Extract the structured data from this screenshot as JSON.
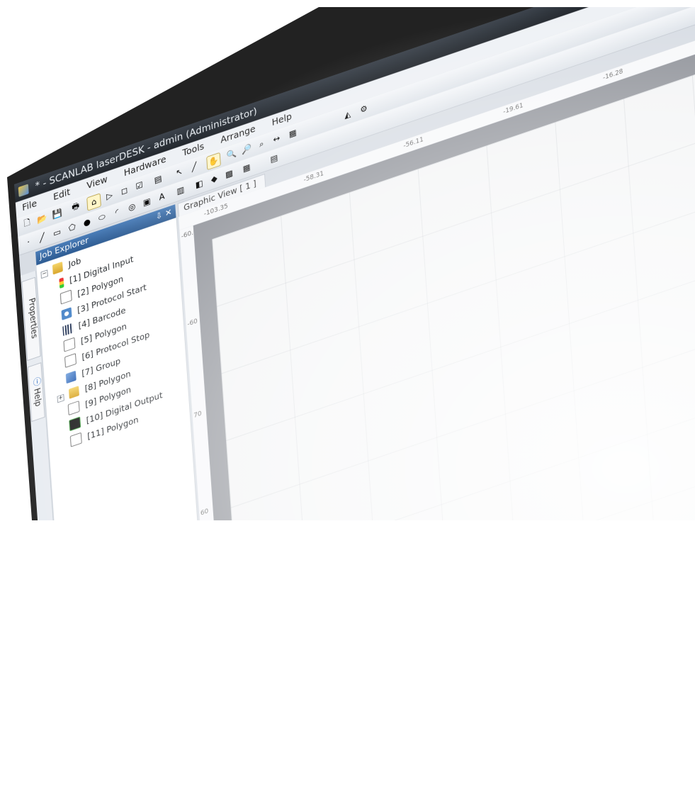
{
  "window": {
    "title": "* - SCANLAB laserDESK - admin (Administrator)"
  },
  "menu": [
    "File",
    "Edit",
    "View",
    "Hardware",
    "Tools",
    "Arrange",
    "Help"
  ],
  "panel": {
    "title": "Job Explorer",
    "controls": "⇩ ✕"
  },
  "side_tabs": {
    "properties": "Properties",
    "help": "Help"
  },
  "tree": {
    "root": "Job",
    "items": [
      "[1] Digital Input",
      "[2] Polygon",
      "[3] Protocol Start",
      "[4] Barcode",
      "[5] Polygon",
      "[6] Protocol Stop",
      "[7] Group",
      "[8] Polygon",
      "[9] Polygon",
      "[10] Digital Output",
      "[11] Polygon"
    ]
  },
  "graphic_view": {
    "tab_label": "Graphic View [ 1 ]"
  },
  "ruler": {
    "top_labels": [
      "-103.35",
      "-58.31",
      "-56.11",
      "-19.61",
      "-16.28"
    ],
    "left_labels": [
      "-60.0",
      "-60",
      "70",
      "60"
    ]
  },
  "colors": {
    "titlebar": "#2a3037",
    "panel_header": "#3f70aa",
    "canvas_margin": "#8e9198",
    "canvas_page": "#f3f4f5"
  }
}
